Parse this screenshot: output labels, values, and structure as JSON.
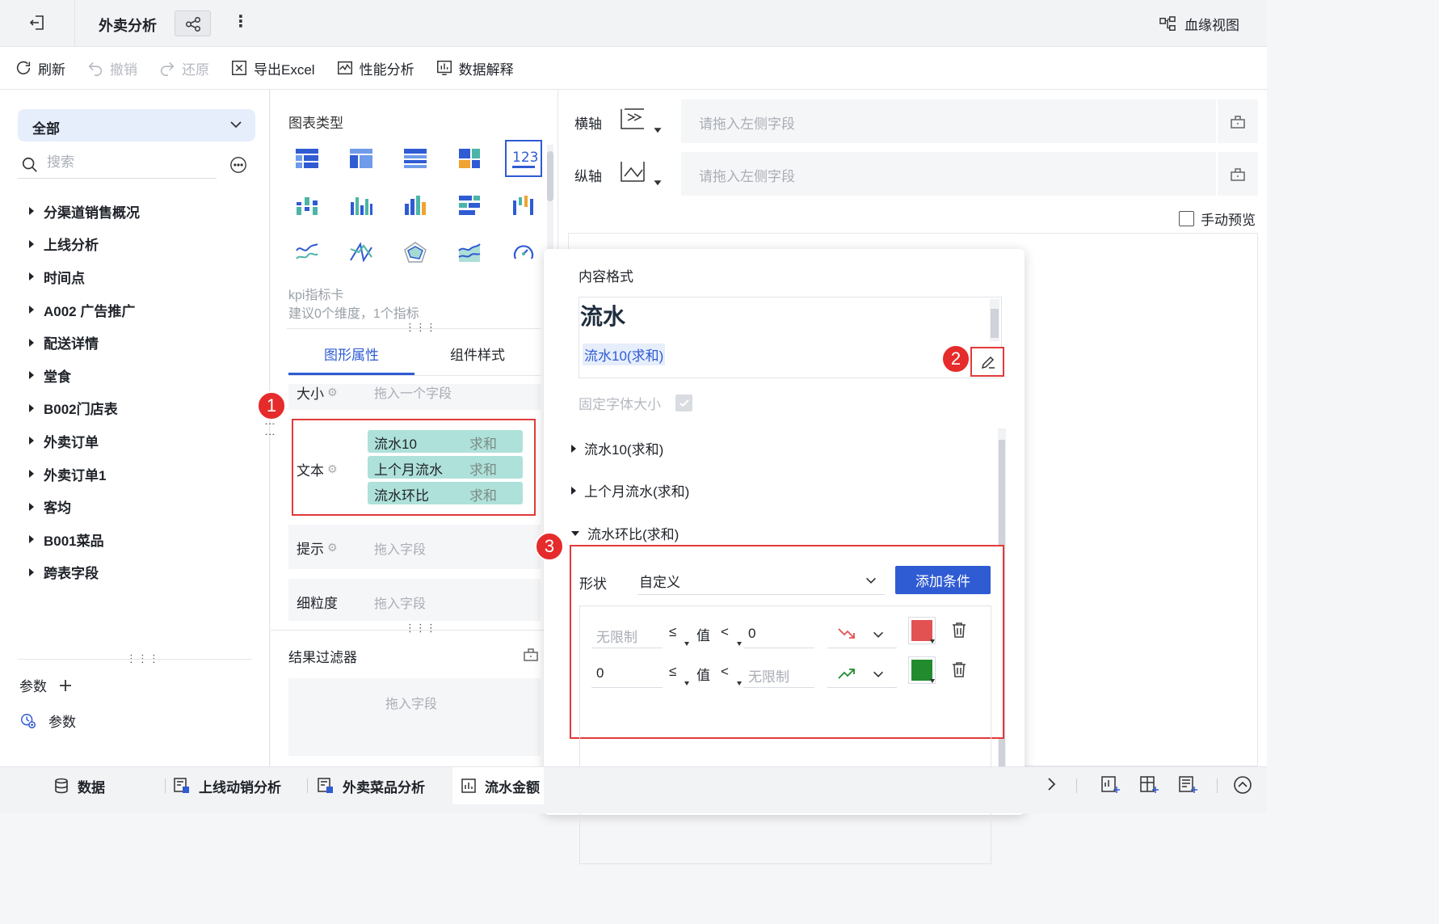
{
  "header": {
    "title": "外卖分析",
    "lineage_label": "血缘视图"
  },
  "toolbar": {
    "refresh": "刷新",
    "undo": "撤销",
    "redo": "还原",
    "export_excel": "导出Excel",
    "perf_analysis": "性能分析",
    "data_explain": "数据解释"
  },
  "left": {
    "scope": "全部",
    "search_placeholder": "搜索",
    "tree": [
      {
        "label": "分渠道销售概况"
      },
      {
        "label": "上线分析"
      },
      {
        "label": "时间点"
      },
      {
        "label": "A002 广告推广"
      },
      {
        "label": "配送详情"
      },
      {
        "label": "堂食"
      },
      {
        "label": "B002门店表"
      },
      {
        "label": "外卖订单"
      },
      {
        "label": "外卖订单1"
      },
      {
        "label": "客均"
      },
      {
        "label": "B001菜品"
      },
      {
        "label": "跨表字段"
      }
    ],
    "params_header": "参数",
    "params_item": "参数"
  },
  "middle": {
    "chart_type_header": "图表类型",
    "kpi_name": "kpi指标卡",
    "kpi_hint": "建议0个维度，1个指标",
    "tabs": [
      "图形属性",
      "组件样式"
    ],
    "size_label": "大小",
    "size_placeholder": "拖入一个字段",
    "text_label": "文本",
    "text_fields": [
      {
        "name": "流水10",
        "agg": "求和"
      },
      {
        "name": "上个月流水",
        "agg": "求和"
      },
      {
        "name": "流水环比",
        "agg": "求和"
      }
    ],
    "tip_label": "提示",
    "tip_placeholder": "拖入字段",
    "grain_label": "细粒度",
    "grain_placeholder": "拖入字段",
    "filter_header": "结果过滤器",
    "filter_placeholder": "拖入字段"
  },
  "right": {
    "x_axis_label": "横轴",
    "y_axis_label": "纵轴",
    "axis_placeholder": "请拖入左侧字段",
    "manual_preview": "手动预览"
  },
  "popover": {
    "title": "内容格式",
    "preview_big": "流水",
    "preview_field": "流水10(求和)",
    "fixed_font": "固定字体大小",
    "sections": [
      "流水10(求和)",
      "上个月流水(求和)",
      "流水环比(求和)"
    ],
    "shape_label": "形状",
    "shape_value": "自定义",
    "add_condition": "添加条件",
    "rules": [
      {
        "min": "无限制",
        "op1": "≤",
        "mid": "值",
        "op2": "<",
        "max": "0",
        "trend": "down",
        "color": "#e35252"
      },
      {
        "min": "0",
        "op1": "≤",
        "mid": "值",
        "op2": "<",
        "max": "无限制",
        "trend": "up",
        "color": "#228b2e"
      }
    ]
  },
  "badges": [
    "1",
    "2",
    "3"
  ],
  "bottom_tabs": {
    "data": "数据",
    "tab1": "上线动销分析",
    "tab2": "外卖菜品分析",
    "tab3": "流水金额"
  },
  "colors": {
    "accent": "#2f5bd3",
    "highlight_red": "#e23a3a",
    "chip_bg": "#aee1d9",
    "down_red": "#e35252",
    "up_green": "#228b2e"
  }
}
